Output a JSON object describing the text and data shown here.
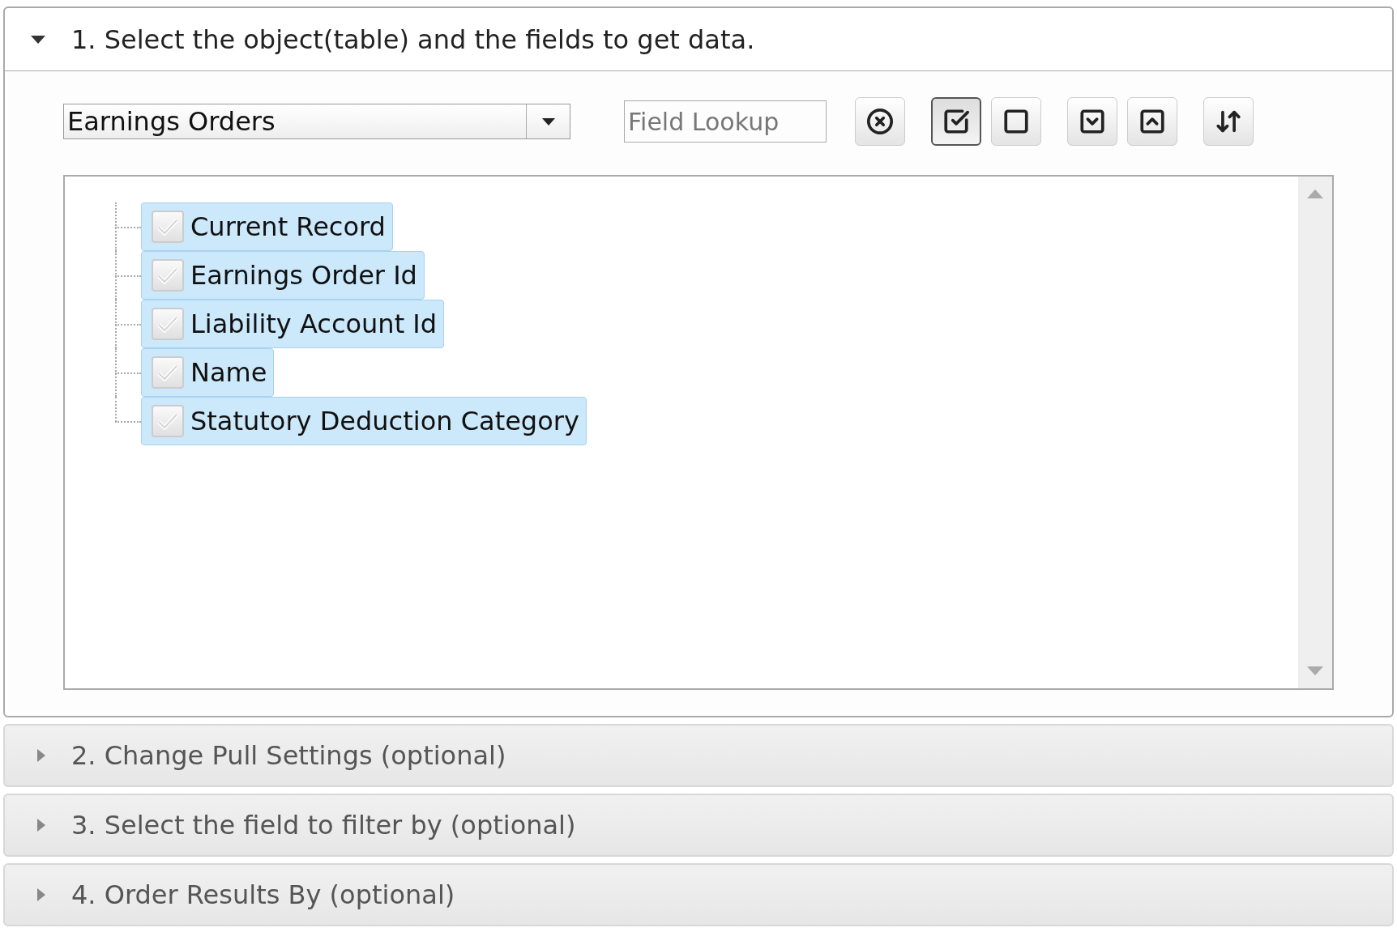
{
  "sections": [
    {
      "title": "1. Select the object(table) and the fields to get data.",
      "expanded": true
    },
    {
      "title": "2. Change Pull Settings (optional)",
      "expanded": false
    },
    {
      "title": "3. Select the field to filter by (optional)",
      "expanded": false
    },
    {
      "title": "4. Order Results By (optional)",
      "expanded": false
    }
  ],
  "object_select": {
    "value": "Earnings Orders"
  },
  "field_lookup": {
    "placeholder": "Field Lookup"
  },
  "toolbar": [
    {
      "kind": "clear",
      "pressed": false
    },
    {
      "kind": "check-all",
      "pressed": true
    },
    {
      "kind": "uncheck-all",
      "pressed": false
    },
    {
      "kind": "expand",
      "pressed": false
    },
    {
      "kind": "collapse",
      "pressed": false
    },
    {
      "kind": "sort",
      "pressed": false
    }
  ],
  "fields": [
    {
      "label": "Current Record",
      "checked": true,
      "selected": true
    },
    {
      "label": "Earnings Order Id",
      "checked": true,
      "selected": true
    },
    {
      "label": "Liability Account Id",
      "checked": true,
      "selected": true
    },
    {
      "label": "Name",
      "checked": true,
      "selected": true
    },
    {
      "label": "Statutory Deduction Category",
      "checked": true,
      "selected": true
    }
  ]
}
